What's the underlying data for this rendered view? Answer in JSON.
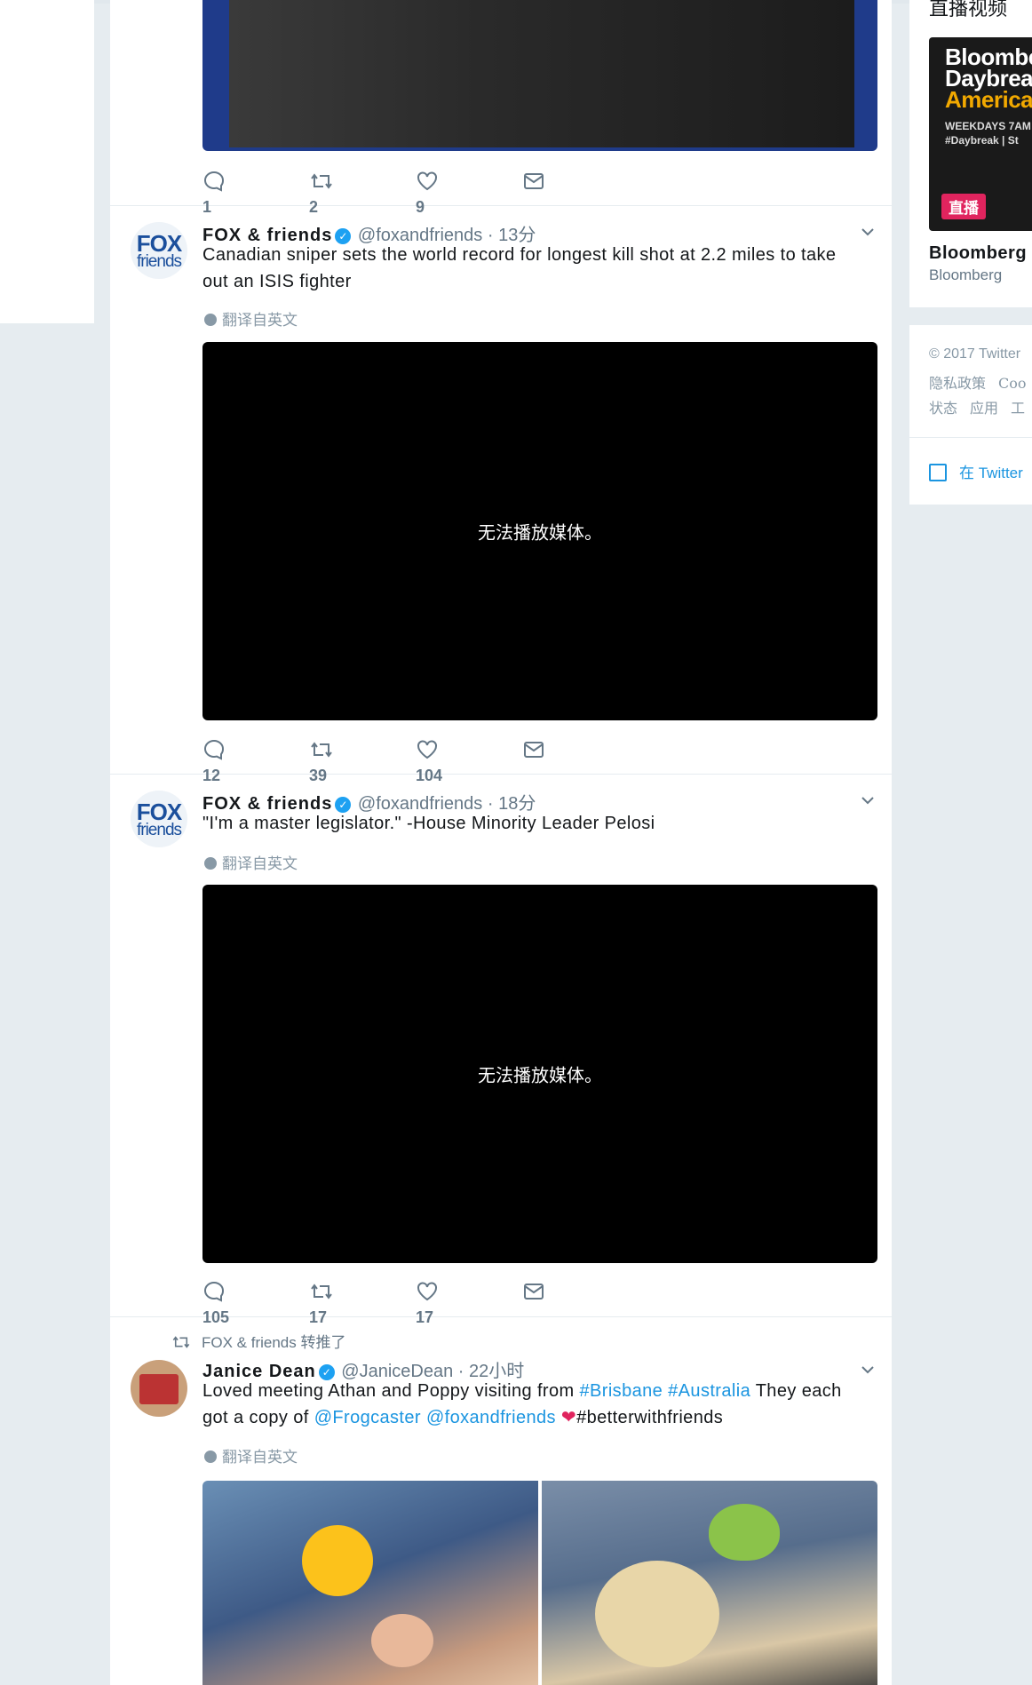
{
  "tweet_top": {
    "replies": "1",
    "retweets": "2",
    "likes": "9"
  },
  "tweets": [
    {
      "author": "FOX & friends",
      "handle": "@foxandfriends",
      "time": "· 13分",
      "avatar_line1": "FOX",
      "avatar_line2": "friends",
      "text": "Canadian sniper sets the world record for longest kill shot at 2.2 miles to take out an ISIS fighter",
      "translate": "翻译自英文",
      "media_msg": "无法播放媒体。",
      "replies": "12",
      "retweets": "39",
      "likes": "104"
    },
    {
      "author": "FOX & friends",
      "handle": "@foxandfriends",
      "time": "· 18分",
      "avatar_line1": "FOX",
      "avatar_line2": "friends",
      "text": "\"I'm a master legislator.\" -House Minority Leader Pelosi",
      "translate": "翻译自英文",
      "media_msg": "无法播放媒体。",
      "replies": "105",
      "retweets": "17",
      "likes": "17"
    }
  ],
  "retweet": {
    "context": "FOX & friends 转推了",
    "author": "Janice Dean",
    "handle": "@JaniceDean",
    "time": "· 22小时",
    "text_1": "Loved meeting Athan and Poppy visiting from ",
    "tag_1": "#Brisbane",
    "tag_2": "#Australia",
    "text_2": " They each got a copy of ",
    "mention_1": "@Frogcaster",
    "mention_2": "@foxandfriends",
    "text_3": "#betterwithfriends",
    "translate": "翻译自英文"
  },
  "sidebar": {
    "section_title": "直播视频",
    "card_line1": "Bloomberg",
    "card_line2": "Daybreak",
    "card_line3": "Americas",
    "card_line4": "WEEKDAYS 7AM",
    "card_line5": "#Daybreak | St",
    "live_label": "直播",
    "channel_name": "Bloomberg",
    "channel_sub": "Bloomberg",
    "copyright": "© 2017 Twitter",
    "footer_row2": [
      "隐私政策",
      "Coo"
    ],
    "footer_row3": [
      "状态",
      "应用",
      "工"
    ],
    "open_in": "在 Twitter"
  },
  "colors": {
    "accent": "#1da1f2",
    "link": "#1b95e0",
    "live": "#e0245e",
    "like_heart": "#e0245e"
  }
}
